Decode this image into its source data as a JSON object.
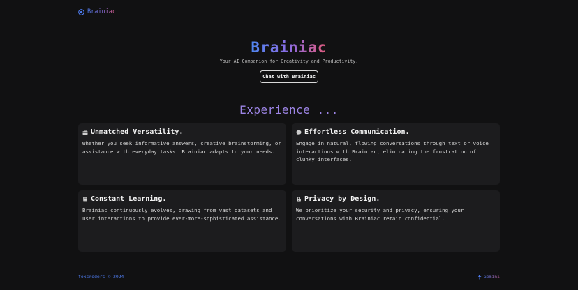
{
  "header": {
    "brand": "Brainiac",
    "logo_icon": "target-icon"
  },
  "hero": {
    "title": "Brainiac",
    "subtitle": "Your AI Companion for Creativity and Productivity.",
    "cta_label": "Chat with Brainiac"
  },
  "experience": {
    "title": "Experience ...",
    "cards": [
      {
        "icon": "briefcase-icon",
        "title": "Unmatched Versatility.",
        "body": "Whether you seek informative answers, creative brainstorming, or assistance with everyday tasks, Brainiac adapts to your needs."
      },
      {
        "icon": "speech-bubble-icon",
        "title": "Effortless Communication.",
        "body": "Engage in natural, flowing conversations through text or voice interactions with Brainiac, eliminating the frustration of clunky interfaces."
      },
      {
        "icon": "book-icon",
        "title": "Constant Learning.",
        "body": "Brainiac continuously evolves, drawing from vast datasets and user interactions to provide ever-more-sophisticated assistance."
      },
      {
        "icon": "lock-icon",
        "title": "Privacy by Design.",
        "body": "We prioritize your security and privacy, ensuring your conversations with Brainiac remain confidential."
      }
    ]
  },
  "footer": {
    "copyright": "foxcroders © 2024",
    "powered_by": "Gemini",
    "powered_icon": "lightning-icon"
  },
  "colors": {
    "background": "#111112",
    "card_background": "#1c1c1e",
    "accent_blue": "#4f7df0",
    "accent_purple": "#9d85e6",
    "accent_pink": "#e25a7a"
  }
}
